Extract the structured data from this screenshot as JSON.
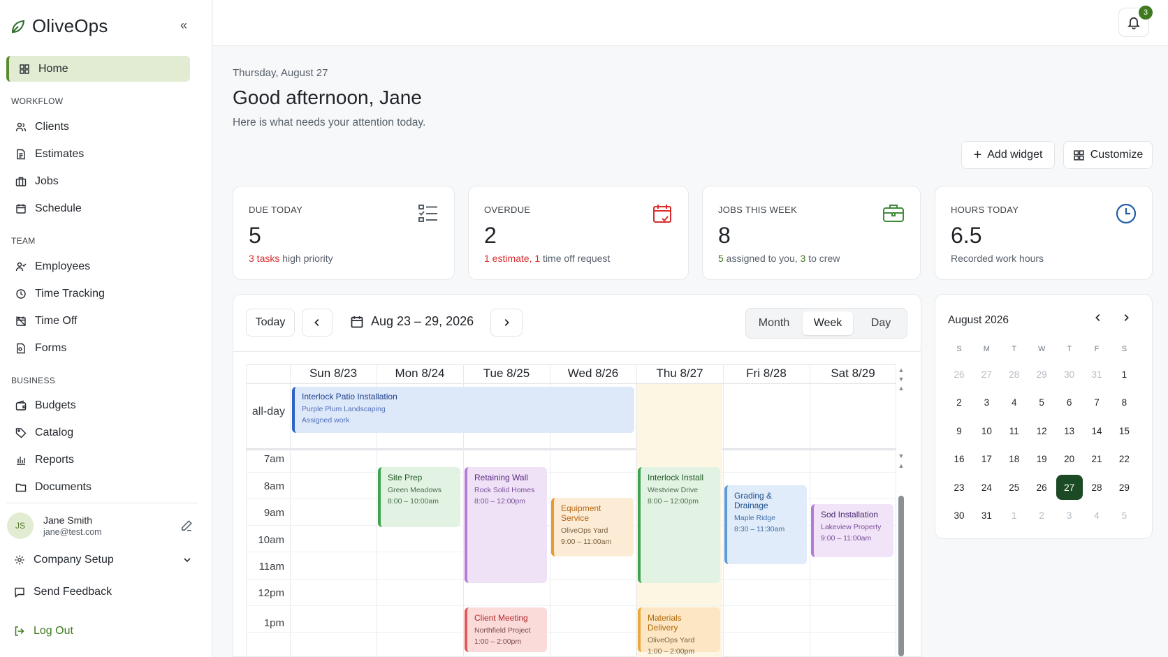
{
  "app": {
    "name": "OliveOps"
  },
  "sidebar": {
    "home": "Home",
    "sections": {
      "workflow": "WORKFLOW",
      "team": "TEAM",
      "business": "BUSINESS"
    },
    "workflow_items": [
      "Clients",
      "Estimates",
      "Jobs",
      "Schedule"
    ],
    "team_items": [
      "Employees",
      "Time Tracking",
      "Time Off",
      "Forms"
    ],
    "business_items": [
      "Budgets",
      "Catalog",
      "Reports",
      "Documents"
    ],
    "user": {
      "initials": "JS",
      "name": "Jane Smith",
      "email": "jane@test.com"
    },
    "company_setup": "Company Setup",
    "send_feedback": "Send Feedback",
    "log_out": "Log Out"
  },
  "header": {
    "notification_count": "3"
  },
  "main": {
    "date": "Thursday, August 27",
    "greeting": "Good afternoon, Jane",
    "subtitle": "Here is what needs your attention today.",
    "add_widget": "Add widget",
    "customize": "Customize"
  },
  "stats": {
    "due_today": {
      "label": "DUE TODAY",
      "value": "5",
      "note_highlight": "3 tasks",
      "note_rest": " high priority"
    },
    "overdue": {
      "label": "OVERDUE",
      "value": "2",
      "note_a": "1 estimate,",
      "note_b": "1",
      "note_c": " time off request"
    },
    "jobs_week": {
      "label": "JOBS THIS WEEK",
      "value": "8",
      "note_a": "5",
      "note_b": " assigned to you, ",
      "note_c": "3",
      "note_d": " to crew"
    },
    "hours_today": {
      "label": "HOURS TODAY",
      "value": "6.5",
      "note": "Recorded work hours"
    }
  },
  "calendar": {
    "today": "Today",
    "range": "Aug 23 – 29, 2026",
    "views": [
      "Month",
      "Week",
      "Day"
    ],
    "active_view": "Week",
    "days": [
      "Sun 8/23",
      "Mon 8/24",
      "Tue 8/25",
      "Wed 8/26",
      "Thu 8/27",
      "Fri 8/28",
      "Sat 8/29"
    ],
    "all_day_label": "all-day",
    "times": [
      "7am",
      "8am",
      "9am",
      "10am",
      "11am",
      "12pm",
      "1pm"
    ],
    "all_day_event": {
      "title": "Interlock Patio Installation",
      "client": "Purple Plum Landscaping",
      "note": "Assigned work"
    },
    "events": [
      {
        "title": "Site Prep",
        "place": "Green Meadows",
        "time": "8:00 – 10:00am",
        "color": "#3fa34d"
      },
      {
        "title": "Retaining Wall",
        "place": "Rock Solid Homes",
        "time": "8:00 – 12:00pm",
        "color": "#b57ad6"
      },
      {
        "title": "Equipment Service",
        "place": "OliveOps Yard",
        "time": "9:00 – 11:00am",
        "color": "#e89a2c"
      },
      {
        "title": "Interlock Install",
        "place": "Westview Drive",
        "time": "8:00 – 12:00pm",
        "color": "#3fa34d"
      },
      {
        "title": "Grading & Drainage",
        "place": "Maple Ridge",
        "time": "8:30 – 11:30am",
        "color": "#5b9bd5"
      },
      {
        "title": "Sod Installation",
        "place": "Lakeview Property",
        "time": "9:00 – 11:00am",
        "color": "#b57ad6"
      },
      {
        "title": "Client Meeting",
        "place": "Northfield Project",
        "time": "1:00 – 2:00pm",
        "color": "#e05a5a"
      },
      {
        "title": "Materials Delivery",
        "place": "OliveOps Yard",
        "time": "1:00 – 2:00pm",
        "color": "#e8a83a"
      }
    ]
  },
  "mini_calendar": {
    "title": "August 2026",
    "dow": [
      "S",
      "M",
      "T",
      "W",
      "T",
      "F",
      "S"
    ],
    "weeks": [
      [
        "26",
        "27",
        "28",
        "29",
        "30",
        "31",
        "1"
      ],
      [
        "2",
        "3",
        "4",
        "5",
        "6",
        "7",
        "8"
      ],
      [
        "9",
        "10",
        "11",
        "12",
        "13",
        "14",
        "15"
      ],
      [
        "16",
        "17",
        "18",
        "19",
        "20",
        "21",
        "22"
      ],
      [
        "23",
        "24",
        "25",
        "26",
        "27",
        "28",
        "29"
      ],
      [
        "30",
        "31",
        "1",
        "2",
        "3",
        "4",
        "5"
      ]
    ],
    "selected": "27"
  },
  "colors": {
    "accent": "#3f7a1f",
    "selected_day": "#1c4a25",
    "alert": "#d92d2d",
    "clock_icon": "#1f5fa6"
  }
}
